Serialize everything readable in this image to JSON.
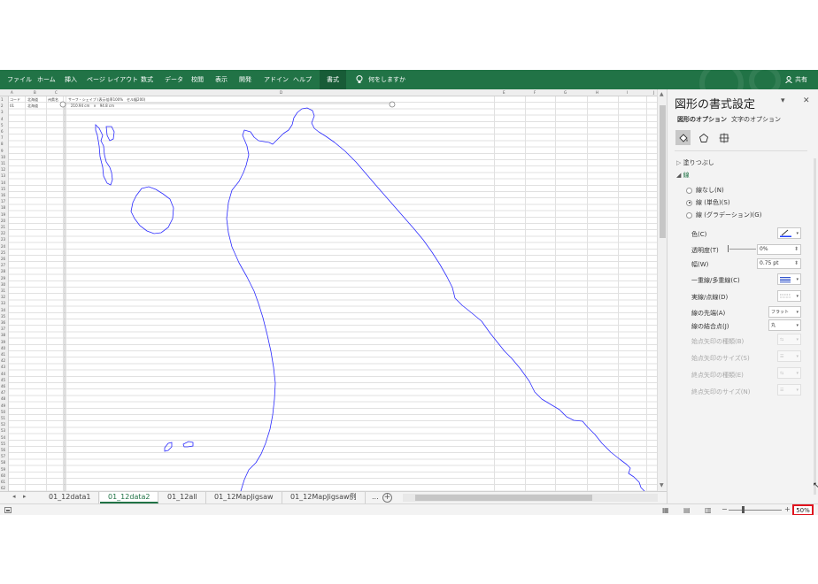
{
  "ribbon": {
    "tabs": [
      {
        "label": "ファイル",
        "name": "tab-file"
      },
      {
        "label": "ホーム",
        "name": "tab-home"
      },
      {
        "label": "挿入",
        "name": "tab-insert"
      },
      {
        "label": "ページ レイアウト",
        "name": "tab-page-layout"
      },
      {
        "label": "数式",
        "name": "tab-formulas"
      },
      {
        "label": "データ",
        "name": "tab-data"
      },
      {
        "label": "校閲",
        "name": "tab-review"
      },
      {
        "label": "表示",
        "name": "tab-view"
      },
      {
        "label": "開発",
        "name": "tab-developer"
      },
      {
        "label": "アドイン",
        "name": "tab-addins"
      },
      {
        "label": "ヘルプ",
        "name": "tab-help"
      },
      {
        "label": "書式",
        "name": "tab-format"
      }
    ],
    "tell_me": "何をしますか",
    "share": "共有",
    "color": "#217346"
  },
  "sheet": {
    "columns": [
      "A",
      "B",
      "C",
      "D",
      "E",
      "F",
      "G",
      "H",
      "I",
      "J"
    ],
    "row_count": 62,
    "row1": [
      "コード",
      "北海道",
      "州県名",
      "サーフ・シェイプ (表示倍率100%　セル幅200)"
    ],
    "row2": [
      "01",
      "北海道",
      "210.94 cm　×　94.8 cm"
    ],
    "shape_color": "#2b2bff"
  },
  "sheet_tabs": {
    "tabs": [
      "01_12data1",
      "01_12data2",
      "01_12all",
      "01_12MapJigsaw",
      "01_12MapJigsaw例"
    ],
    "active": "01_12data2",
    "more": "..."
  },
  "status": {
    "zoom": "50%"
  },
  "format_pane": {
    "title": "図形の書式設定",
    "subtabs": [
      "図形のオプション",
      "文字のオプション"
    ],
    "sections": {
      "fill": "塗りつぶし",
      "line": "線"
    },
    "radios": [
      {
        "label": "線なし(N)",
        "checked": false
      },
      {
        "label": "線 (単色)(S)",
        "checked": true
      },
      {
        "label": "線 (グラデーション)(G)",
        "checked": false
      }
    ],
    "props": {
      "color": "色(C)",
      "transparency": "透明度(T)",
      "transparency_value": "0%",
      "width": "幅(W)",
      "width_value": "0.75 pt",
      "compound": "一重線/多重線(C)",
      "dash": "実線/点線(D)",
      "cap": "線の先端(A)",
      "cap_value": "フラット",
      "join": "線の結合点(J)",
      "join_value": "丸",
      "begin_arrow_type": "始点矢印の種類(B)",
      "begin_arrow_size": "始点矢印のサイズ(S)",
      "end_arrow_type": "終点矢印の種類(E)",
      "end_arrow_size": "終点矢印のサイズ(N)"
    },
    "line_color": "#1f3fff"
  }
}
